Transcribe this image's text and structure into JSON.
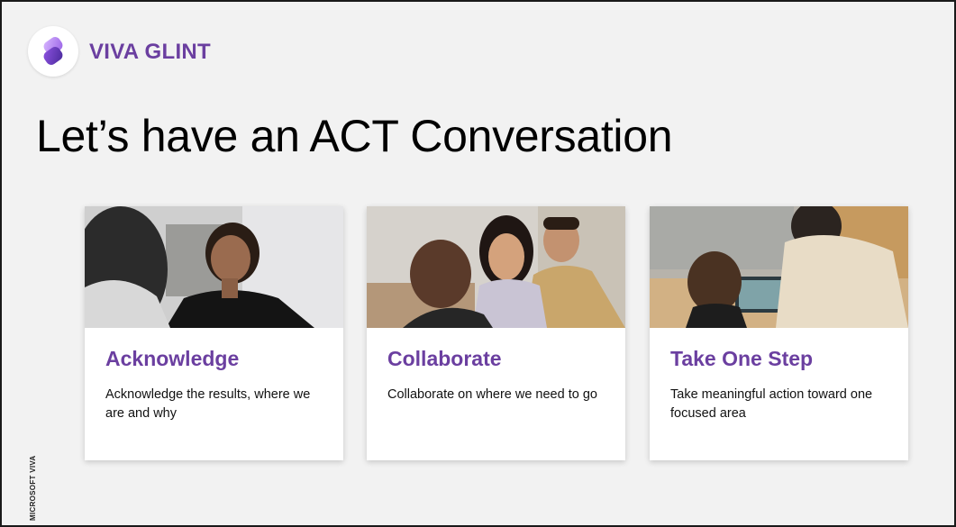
{
  "brand": {
    "name": "VIVA GLINT",
    "logo_icon": "viva-glint-logo-icon",
    "accent_color": "#6b3fa0"
  },
  "title": "Let’s have an ACT Conversation",
  "cards": [
    {
      "heading": "Acknowledge",
      "description": "Acknowledge the results, where we are and why",
      "photo": "photo-two-women-talking"
    },
    {
      "heading": "Collaborate",
      "description": "Collaborate on where we need to go",
      "photo": "photo-team-meeting"
    },
    {
      "heading": "Take One Step",
      "description": "Take meaningful action toward one focused area",
      "photo": "photo-coworkers-at-laptop"
    }
  ],
  "footer_label": "MICROSOFT VIVA"
}
